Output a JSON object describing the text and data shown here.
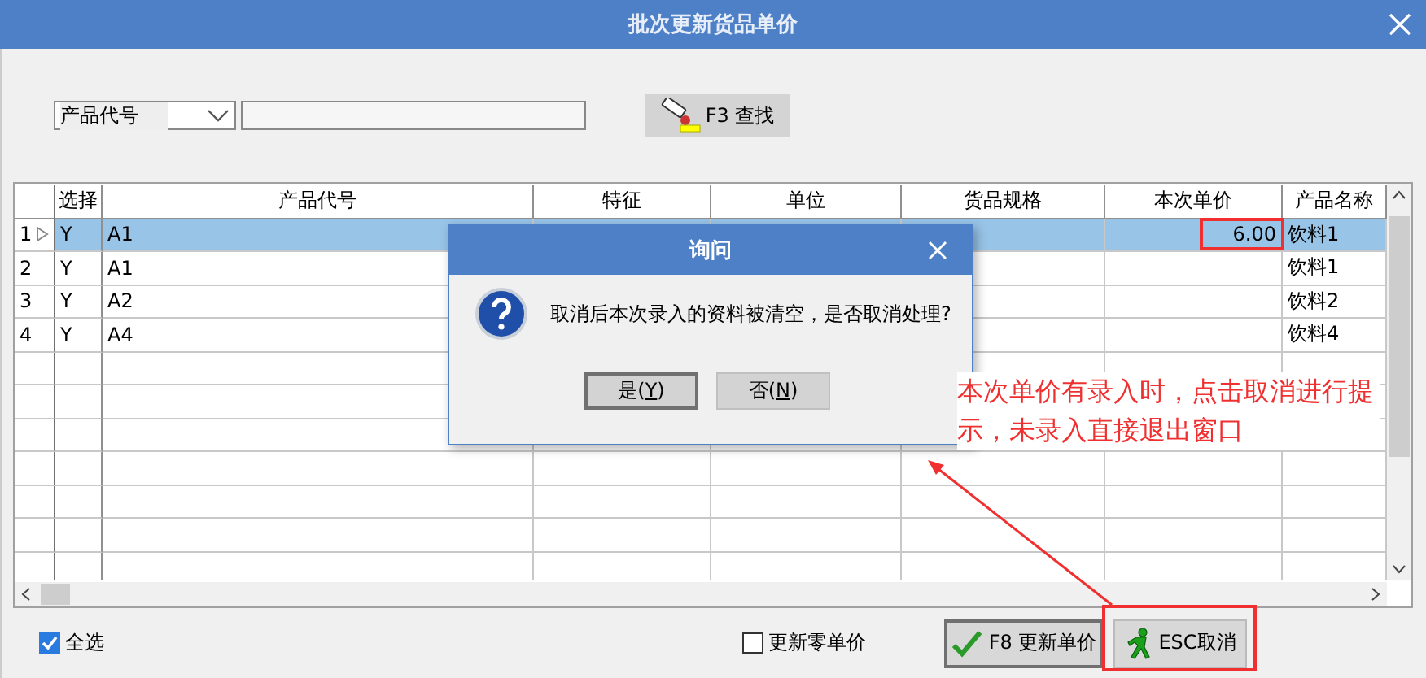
{
  "window": {
    "title": "批次更新货品单价"
  },
  "search": {
    "field": "产品代号",
    "button": "F3 查找"
  },
  "table": {
    "columns": [
      "选择",
      "产品代号",
      "特征",
      "单位",
      "货品规格",
      "本次单价",
      "产品名称"
    ],
    "rows": [
      {
        "number": "1",
        "current": true,
        "selected": true,
        "cells": [
          "Y",
          "A1",
          null,
          null,
          null,
          "6.00",
          "饮料1"
        ]
      },
      {
        "number": "2",
        "current": false,
        "selected": false,
        "cells": [
          "Y",
          "A1",
          null,
          null,
          null,
          null,
          "饮料1"
        ]
      },
      {
        "number": "3",
        "current": false,
        "selected": false,
        "cells": [
          "Y",
          "A2",
          null,
          null,
          null,
          null,
          "饮料2"
        ]
      },
      {
        "number": "4",
        "current": false,
        "selected": false,
        "cells": [
          "Y",
          "A4",
          null,
          null,
          null,
          null,
          "饮料4"
        ]
      }
    ]
  },
  "bottom": {
    "select_all": {
      "label": "全选",
      "checked": true
    },
    "update_zero": {
      "label": "更新零单价",
      "checked": false
    },
    "buttons": [
      {
        "kind": "confirm",
        "label": "F8 更新单价",
        "default": true
      },
      {
        "kind": "cancel",
        "label": "ESC取消",
        "default": false
      }
    ]
  },
  "dialog": {
    "title": "询问",
    "message": "取消后本次录入的资料被清空，是否取消处理?",
    "buttons": [
      {
        "prefix": "是(",
        "key": "Y",
        "suffix": ")",
        "default": true
      },
      {
        "prefix": "否(",
        "key": "N",
        "suffix": ")",
        "default": false
      }
    ]
  },
  "annotation": {
    "text": "本次单价有录入时，点击取消进行提示，未录入直接退出窗口"
  }
}
